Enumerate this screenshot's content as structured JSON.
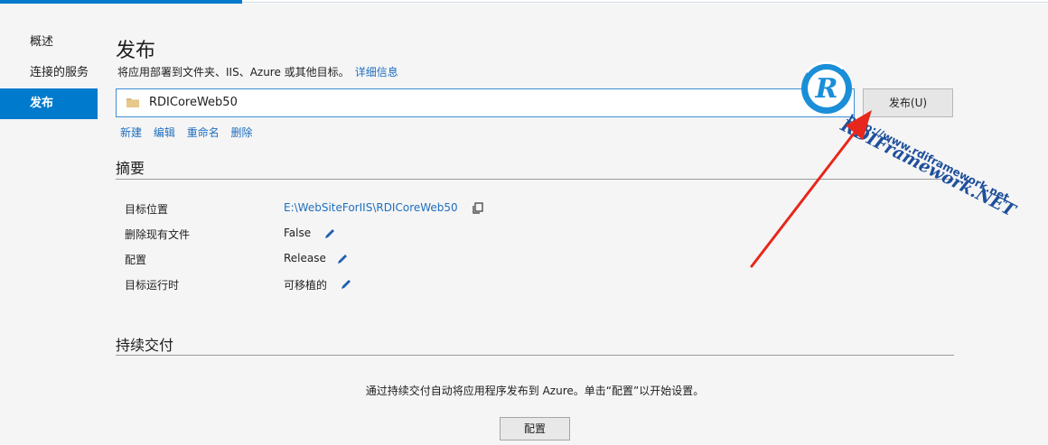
{
  "sidebar": {
    "items": [
      {
        "label": "概述"
      },
      {
        "label": "连接的服务"
      },
      {
        "label": "发布"
      }
    ]
  },
  "main": {
    "title": "发布",
    "subtitle": "将应用部署到文件夹、IIS、Azure 或其他目标。",
    "subtitle_link": "详细信息",
    "profile": {
      "name": "RDICoreWeb50",
      "icon": "folder-icon"
    },
    "publish_button": "发布(U)",
    "actions": [
      "新建",
      "编辑",
      "重命名",
      "删除"
    ]
  },
  "summary": {
    "title": "摘要",
    "rows": [
      {
        "label": "目标位置",
        "value": "E:\\WebSiteForIIS\\RDICoreWeb50",
        "icon": "copy-icon"
      },
      {
        "label": "删除现有文件",
        "value": "False",
        "icon": "edit-icon"
      },
      {
        "label": "配置",
        "value": "Release",
        "icon": "edit-icon"
      },
      {
        "label": "目标运行时",
        "value": "可移植的",
        "icon": "edit-icon"
      }
    ]
  },
  "continuous_delivery": {
    "title": "持续交付",
    "note": "通过持续交付自动将应用程序发布到 Azure。单击“配置”以开始设置。",
    "button": "配置"
  },
  "watermark": {
    "logo_letter": "R",
    "text1": "RDIFramework.NET",
    "text2": "http://www.rdiframework.net",
    "arrow_color": "#e8271c"
  },
  "colors": {
    "accent": "#007acc",
    "link": "#1f6fbf"
  }
}
